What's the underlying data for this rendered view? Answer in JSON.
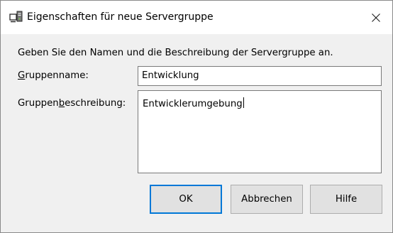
{
  "window": {
    "title": "Eigenschaften für neue Servergruppe",
    "icon": "server-group-icon",
    "close_icon": "close-icon"
  },
  "dialog": {
    "intro": "Geben Sie den Namen und die Beschreibung der Servergruppe an.",
    "name_label_mnemonic": "G",
    "name_label_rest": "ruppenname:",
    "name_value": "Entwicklung",
    "desc_label_prefix": "Gruppen",
    "desc_label_mnemonic": "b",
    "desc_label_rest": "eschreibung:",
    "desc_value": "Entwicklerumgebung"
  },
  "buttons": {
    "ok": "OK",
    "cancel": "Abbrechen",
    "help": "Hilfe"
  },
  "colors": {
    "focus_border": "#0078d7",
    "button_face": "#e1e1e1",
    "dialog_background": "#f0f0f0"
  }
}
